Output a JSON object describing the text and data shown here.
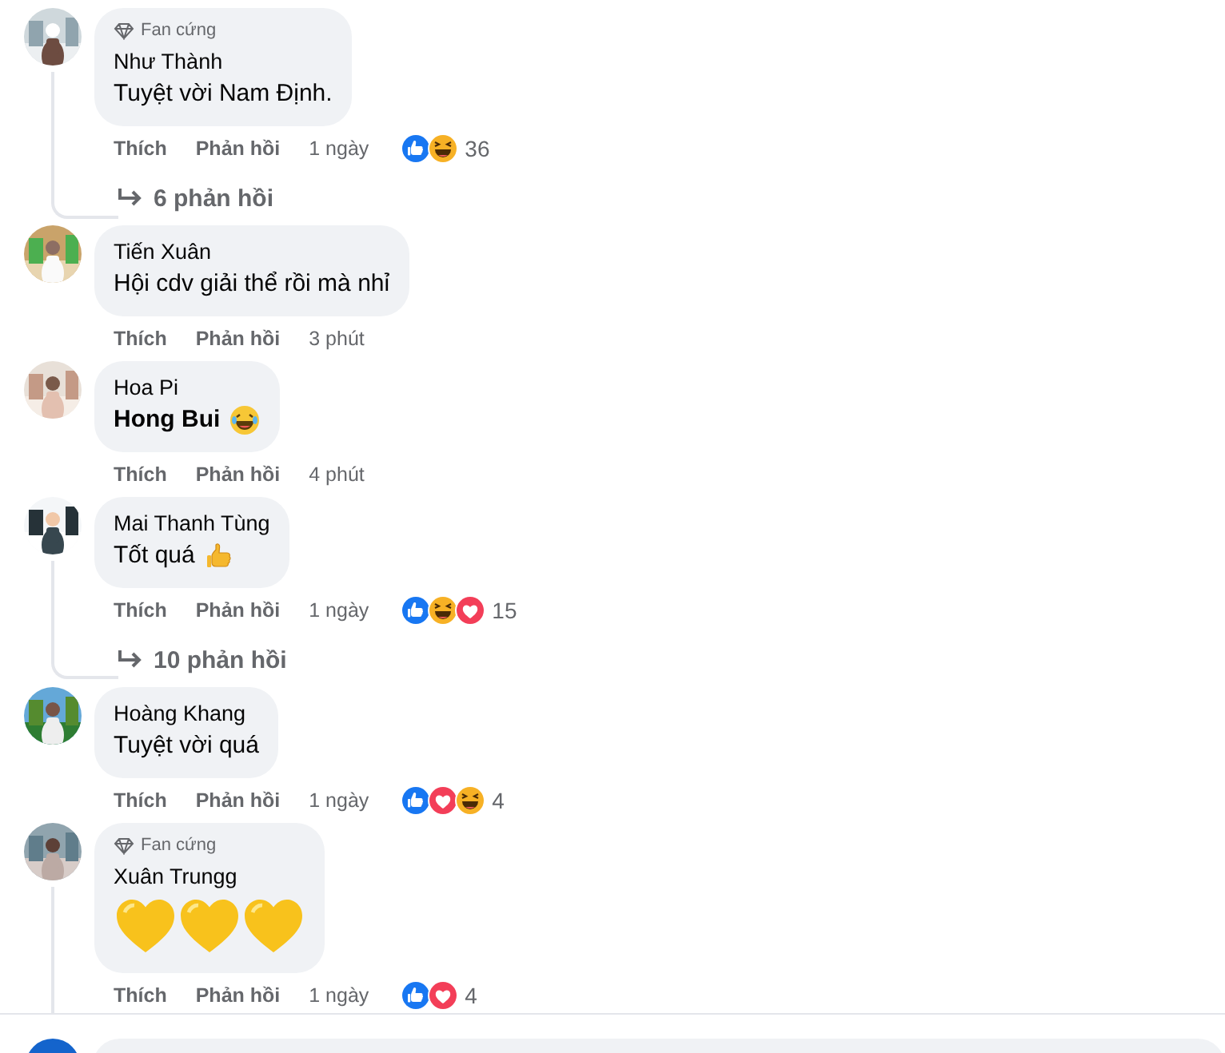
{
  "comments": [
    {
      "badge": "Fan cứng",
      "author": "Như Thành",
      "text": "Tuyệt vời Nam Định.",
      "like": "Thích",
      "reply": "Phản hồi",
      "time": "1 ngày",
      "reactions": [
        {
          "kind": "like"
        },
        {
          "kind": "haha"
        }
      ],
      "reaction_count": "36",
      "replies": "6 phản hồi",
      "thread_line": true
    },
    {
      "author": "Tiến Xuân",
      "text": "Hội cdv giải thể rồi mà nhỉ",
      "like": "Thích",
      "reply": "Phản hồi",
      "time": "3 phút",
      "thread_line": false
    },
    {
      "author": "Hoa Pi",
      "text": "Hong Bui",
      "text_bold": true,
      "emojis": [
        {
          "kind": "laugh"
        }
      ],
      "like": "Thích",
      "reply": "Phản hồi",
      "time": "4 phút",
      "thread_line": false
    },
    {
      "author": "Mai Thanh Tùng",
      "text": "Tốt quá",
      "emojis": [
        {
          "kind": "thumbs"
        }
      ],
      "like": "Thích",
      "reply": "Phản hồi",
      "time": "1 ngày",
      "reactions": [
        {
          "kind": "like"
        },
        {
          "kind": "haha"
        },
        {
          "kind": "love"
        }
      ],
      "reaction_count": "15",
      "replies": "10 phản hồi",
      "thread_line": true
    },
    {
      "author": "Hoàng Khang",
      "text": "Tuyệt vời quá",
      "like": "Thích",
      "reply": "Phản hồi",
      "time": "1 ngày",
      "reactions": [
        {
          "kind": "like"
        },
        {
          "kind": "love"
        },
        {
          "kind": "haha"
        }
      ],
      "reaction_count": "4",
      "thread_line": false
    },
    {
      "badge": "Fan cứng",
      "author": "Xuân Trungg",
      "emojis": [
        {
          "kind": "heart"
        },
        {
          "kind": "heart"
        },
        {
          "kind": "heart"
        }
      ],
      "big_emojis": true,
      "like": "Thích",
      "reply": "Phản hồi",
      "time": "1 ngày",
      "reactions": [
        {
          "kind": "like"
        },
        {
          "kind": "love"
        }
      ],
      "reaction_count": "4",
      "thread_line": true
    }
  ],
  "composer": {
    "kind": "field"
  }
}
